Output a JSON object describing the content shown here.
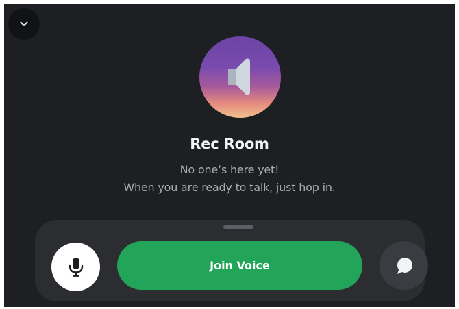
{
  "channel": {
    "name": "Rec Room",
    "empty_title": "No one’s here yet!",
    "empty_subtitle": "When you are ready to talk, just hop in."
  },
  "controls": {
    "collapse_icon": "chevron-down-icon",
    "mic_icon": "microphone-icon",
    "join_label": "Join Voice",
    "chat_icon": "chat-bubble-icon"
  },
  "colors": {
    "background": "#1e1f22",
    "tray": "#2b2d31",
    "join_button": "#23a559",
    "text_primary": "#f2f3f5",
    "text_secondary": "#a9abb1"
  }
}
